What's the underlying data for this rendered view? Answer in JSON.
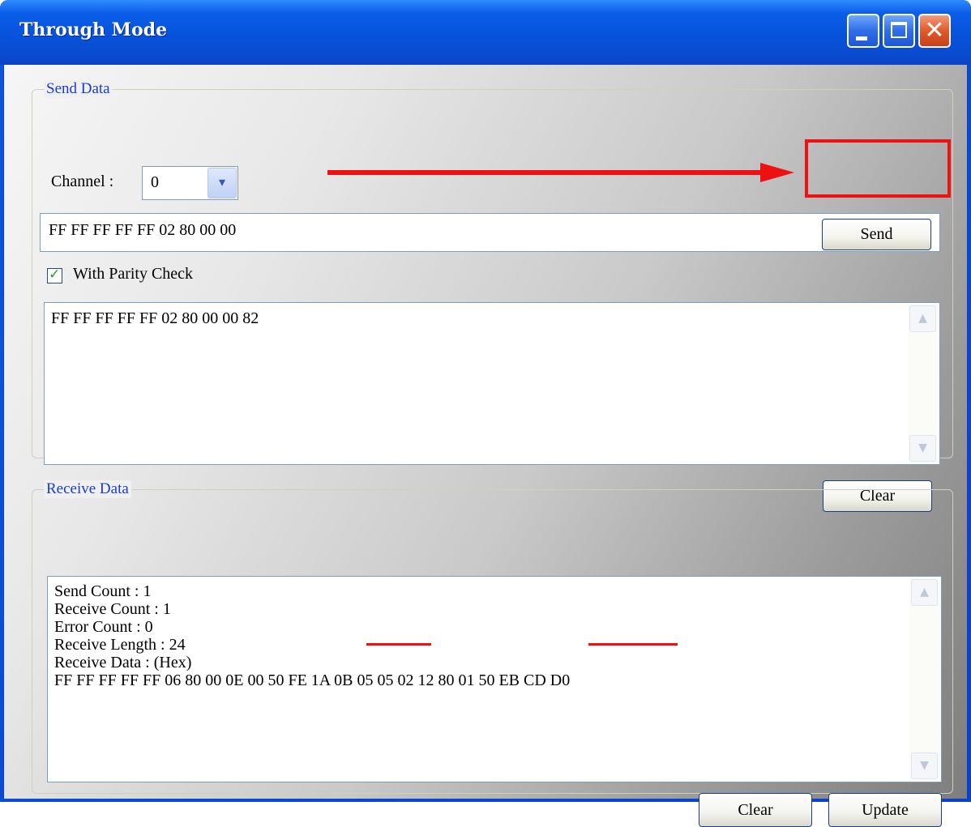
{
  "window": {
    "title": "Through Mode",
    "controls": {
      "minimize": "minimize-icon",
      "maximize": "maximize-icon",
      "close": "close-icon"
    }
  },
  "send_group": {
    "label": "Send Data",
    "channel_label": "Channel :",
    "channel_value": "0",
    "input_value": "FF FF FF FF FF 02 80 00 00",
    "send_button": "Send",
    "parity_checkbox_label": "With Parity Check",
    "parity_checked": true,
    "output_text": "FF FF FF FF FF 02 80 00 00 82",
    "clear_button": "Clear"
  },
  "receive_group": {
    "label": "Receive Data",
    "lines": [
      "Send Count : 1",
      "Receive Count : 1",
      "Error Count : 0",
      "Receive Length : 24",
      "Receive Data : (Hex)",
      "FF FF FF FF FF 06 80 00 0E 00 50 FE 1A 0B 05 05 02 12 80 01 50 EB CD D0"
    ],
    "clear_button": "Clear",
    "update_button": "Update"
  },
  "annotations": {
    "highlight_color": "#ee1111"
  }
}
